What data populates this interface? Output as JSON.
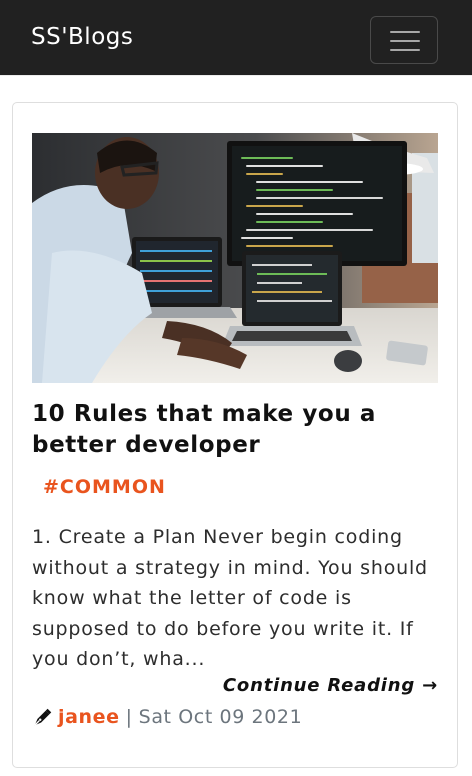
{
  "navbar": {
    "brand": "SS'Blogs",
    "toggler_icon": "hamburger-icon"
  },
  "post": {
    "image_icon": "developer-at-computer-photo",
    "title": "10 Rules that make you a better developer",
    "tag": "#COMMON",
    "excerpt": "1. Create a Plan Never begin coding without a strategy in mind. You should know what the letter of code is supposed to do before you write it. If you don’t, wha...",
    "continue_label": "Continue Reading →",
    "author_icon": "pen-icon",
    "author": "janee",
    "separator": "|",
    "date": "Sat Oct 09 2021"
  },
  "colors": {
    "navbar_bg": "#212121",
    "accent": "#e9541e",
    "text": "#2d2d2d",
    "muted": "#6c757d"
  }
}
